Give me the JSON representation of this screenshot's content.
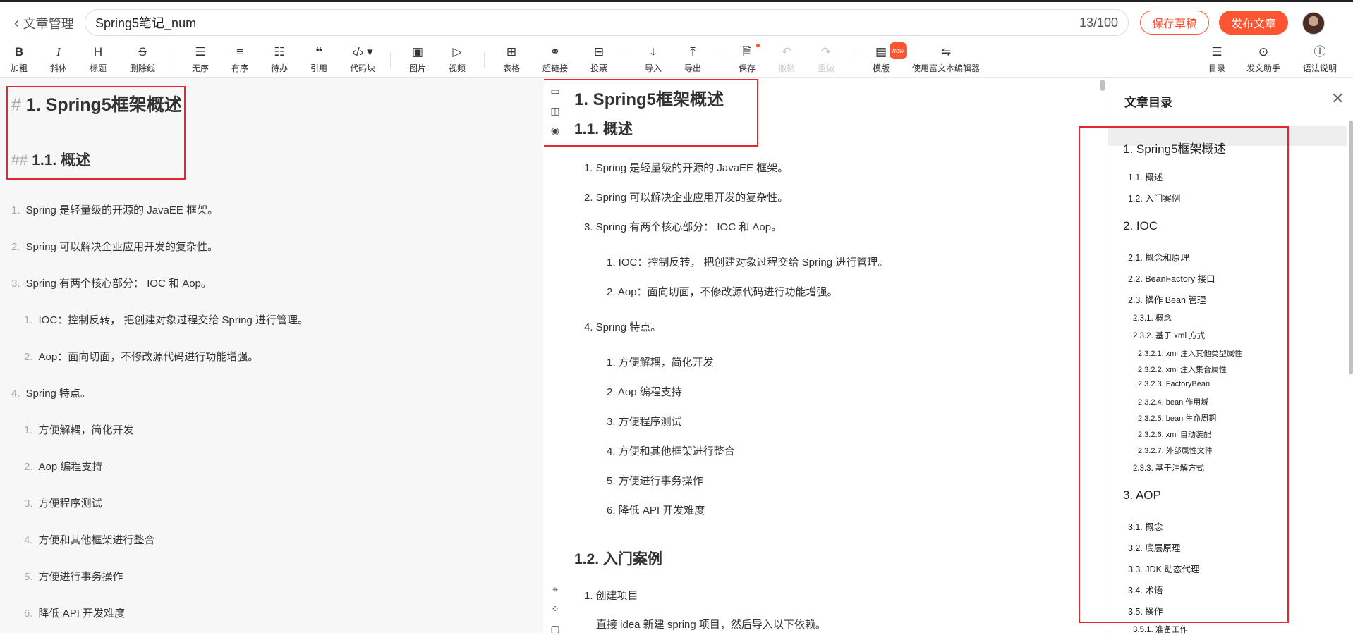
{
  "header": {
    "back_label": "文章管理",
    "title": "Spring5笔记_num",
    "count": "13/100",
    "save_draft": "保存草稿",
    "publish": "发布文章"
  },
  "toolbar": {
    "bold": "加粗",
    "italic": "斜体",
    "heading": "标题",
    "strike": "删除线",
    "ul": "无序",
    "ol": "有序",
    "todo": "待办",
    "quote": "引用",
    "code": "代码块",
    "image": "图片",
    "video": "视频",
    "table": "表格",
    "link": "超链接",
    "vote": "投票",
    "import": "导入",
    "export": "导出",
    "save": "保存",
    "undo": "撤销",
    "redo": "重做",
    "template": "模版",
    "template_badge": "new",
    "rich": "使用富文本编辑器",
    "toc": "目录",
    "assistant": "发文助手",
    "syntax": "语法说明",
    "glyph_bold": "B",
    "glyph_italic": "I",
    "glyph_heading": "H",
    "glyph_strike": "S"
  },
  "editor": {
    "h1_mark": "#",
    "h1": "1. Spring5框架概述",
    "h2_mark": "##",
    "h2": "1.1. 概述",
    "lines": [
      {
        "num": "1.",
        "text": "Spring 是轻量级的开源的 JavaEE 框架。"
      },
      {
        "num": "2.",
        "text": "Spring 可以解决企业应用开发的复杂性。"
      },
      {
        "num": "3.",
        "text": "Spring 有两个核心部分： IOC 和 Aop。"
      },
      {
        "num": "1.",
        "text": "IOC：控制反转， 把创建对象过程交给 Spring 进行管理。"
      },
      {
        "num": "2.",
        "text": "Aop：面向切面，不修改源代码进行功能增强。"
      },
      {
        "num": "4.",
        "text": "Spring 特点。"
      },
      {
        "num": "1.",
        "text": "方便解耦，简化开发"
      },
      {
        "num": "2.",
        "text": "Aop 编程支持"
      },
      {
        "num": "3.",
        "text": "方便程序测试"
      },
      {
        "num": "4.",
        "text": "方便和其他框架进行整合"
      },
      {
        "num": "5.",
        "text": "方便进行事务操作"
      },
      {
        "num": "6.",
        "text": "降低 API 开发难度"
      }
    ]
  },
  "preview": {
    "h1": "1. Spring5框架概述",
    "h2": "1.1. 概述",
    "lines": [
      "1. Spring 是轻量级的开源的 JavaEE 框架。",
      "2. Spring 可以解决企业应用开发的复杂性。",
      "3. Spring 有两个核心部分： IOC 和 Aop。",
      "1. IOC：控制反转， 把创建对象过程交给 Spring 进行管理。",
      "2. Aop：面向切面，不修改源代码进行功能增强。",
      "4. Spring 特点。",
      "1. 方便解耦，简化开发",
      "2. Aop 编程支持",
      "3. 方便程序测试",
      "4. 方便和其他框架进行整合",
      "5. 方便进行事务操作",
      "6. 降低 API 开发难度"
    ],
    "h2b": "1.2. 入门案例",
    "tail1": "1. 创建项目",
    "tail2": "直接 idea 新建 spring 项目，然后导入以下依赖。"
  },
  "toc": {
    "title": "文章目录",
    "items": [
      "1. Spring5框架概述",
      "1.1. 概述",
      "1.2. 入门案例",
      "2. IOC",
      "2.1. 概念和原理",
      "2.2. BeanFactory 接口",
      "2.3. 操作 Bean 管理",
      "2.3.1. 概念",
      "2.3.2. 基于 xml 方式",
      "2.3.2.1. xml 注入其他类型属性",
      "2.3.2.2. xml 注入集合属性",
      "2.3.2.3. FactoryBean",
      "2.3.2.4. bean 作用域",
      "2.3.2.5. bean 生命周期",
      "2.3.2.6. xml 自动装配",
      "2.3.2.7. 外部属性文件",
      "2.3.3. 基于注解方式",
      "3. AOP",
      "3.1. 概念",
      "3.2. 底层原理",
      "3.3. JDK 动态代理",
      "3.4. 术语",
      "3.5. 操作",
      "3.5.1. 准备工作"
    ]
  },
  "colors": {
    "accent": "#fc5531",
    "highlight_box": "#e8262d"
  }
}
